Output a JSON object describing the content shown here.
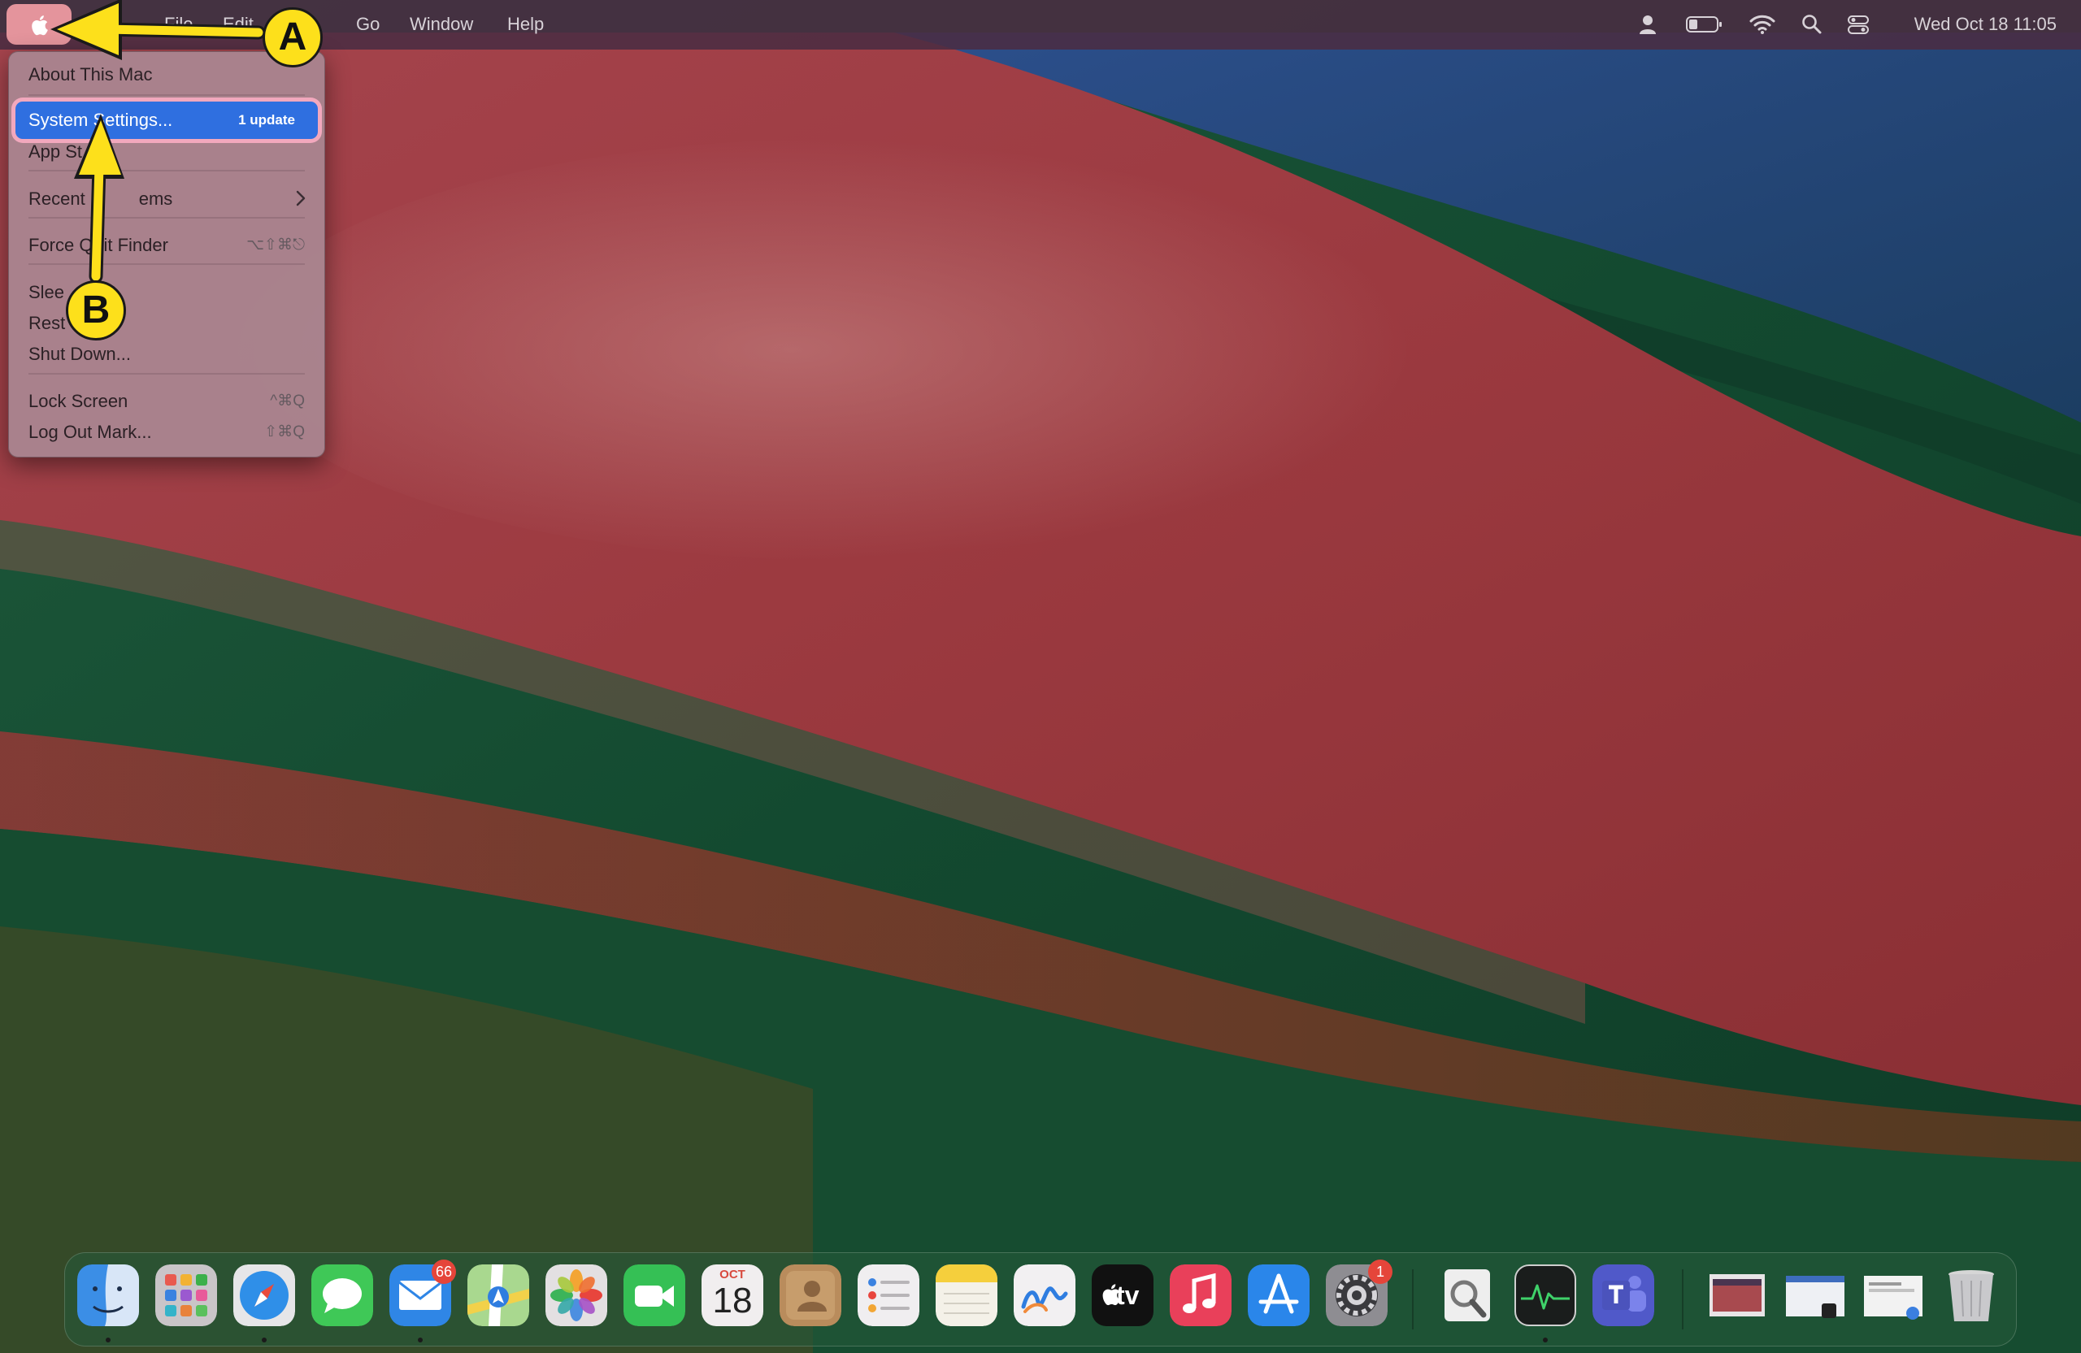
{
  "menubar": {
    "items": [
      "File",
      "Edit",
      "Go",
      "Window",
      "Help"
    ],
    "clock": "Wed Oct 18  11:05",
    "status_icons": [
      "user-icon",
      "battery-icon",
      "wifi-icon",
      "search-icon",
      "control-center-icon"
    ]
  },
  "apple_menu": {
    "about": "About This Mac",
    "system_settings": "System Settings...",
    "system_settings_badge": "1 update",
    "app_store": "App St",
    "recent_items_a": "Recent",
    "recent_items_b": "ems",
    "force_quit_a": "Force Q",
    "force_quit_b": "it Finder",
    "force_quit_shortcut": "⌥⇧⌘⎋",
    "sleep": "Slee",
    "restart": "Rest",
    "shut_down": "Shut Down...",
    "lock_screen": "Lock Screen",
    "lock_screen_shortcut": "^⌘Q",
    "log_out": "Log Out Mark...",
    "log_out_shortcut": "⇧⌘Q"
  },
  "annotations": {
    "marker_a": "A",
    "marker_b": "B",
    "color": "#fde01b"
  },
  "dock": {
    "apps": [
      "Finder",
      "Launchpad",
      "Safari",
      "Messages",
      "Mail",
      "Maps",
      "Photos",
      "FaceTime",
      "Calendar",
      "Contacts",
      "Reminders",
      "Notes",
      "Freeform",
      "TV",
      "Music",
      "App Store",
      "System Settings",
      "Preview",
      "Activity Monitor",
      "Microsoft Teams"
    ],
    "mail_badge": "66",
    "settings_badge": "1",
    "calendar_month": "OCT",
    "calendar_day": "18",
    "tv_label": "tv"
  }
}
